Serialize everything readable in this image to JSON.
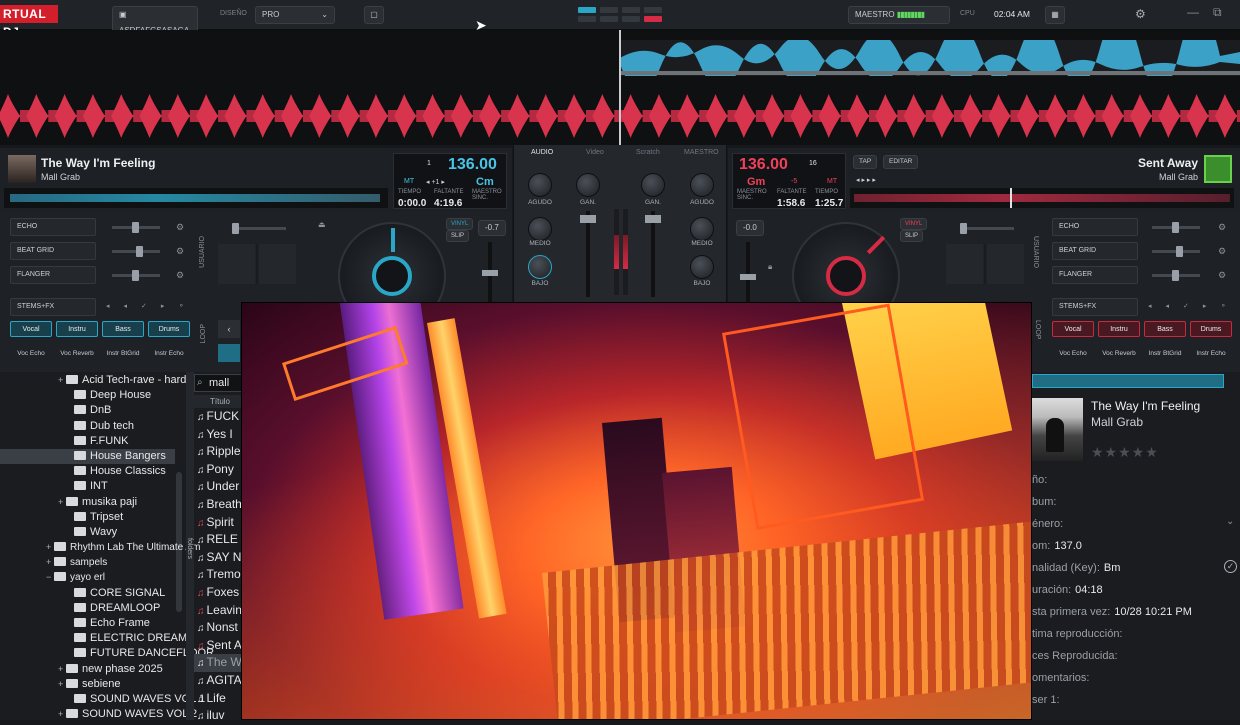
{
  "app": {
    "logo": "RTUAL DJ",
    "user": "ASDFAFGSASAGA...",
    "design_label": "DISEÑO",
    "design_value": "PRO",
    "master_label": "MAESTRO",
    "cpu_label": "CPU",
    "clock": "02:04 AM"
  },
  "left_deck": {
    "title": "The Way I'm Feeling",
    "artist": "Mall Grab",
    "bpm": "136.00",
    "key": "Cm",
    "deck_num": "1",
    "mt": "MT",
    "time_label": "TIEMPO",
    "remain_label": "FALTANTE",
    "sync_label": "MAESTRO SINC.",
    "time": "0:00.0",
    "remain": "4:19.6",
    "pitch": "-0.7",
    "vinyl": "VINYL",
    "slip": "SLIP",
    "fx": [
      "ECHO",
      "BEAT GRID",
      "FLANGER"
    ],
    "stems_label": "STEMS+FX",
    "pads": [
      "Vocal",
      "Instru",
      "Bass",
      "Drums"
    ],
    "pads2": [
      "Voc Echo",
      "Voc Reverb",
      "Instr BtGrid",
      "Instr Echo"
    ],
    "usuario": "USUARIO",
    "loop": "LOOP"
  },
  "right_deck": {
    "title": "Sent Away",
    "artist": "Mall Grab",
    "bpm": "136.00",
    "key": "Gm",
    "deck_num": "16",
    "delta": "-5",
    "mt": "MT",
    "tap": "TAP",
    "edit": "EDITAR",
    "sync_label": "MAESTRO SINC.",
    "remain_label": "FALTANTE",
    "time_label": "TIEMPO",
    "remain": "1:58.6",
    "time": "1:25.7",
    "pitch": "-0.0",
    "vinyl": "VINYL",
    "slip": "SLIP",
    "fx": [
      "ECHO",
      "BEAT GRID",
      "FLANGER"
    ],
    "stems_label": "STEMS+FX",
    "pads": [
      "Vocal",
      "Instru",
      "Bass",
      "Drums"
    ],
    "pads2": [
      "Voc Echo",
      "Voc Reverb",
      "Instr BtGrid",
      "Instr Echo"
    ],
    "usuario": "USUARIO",
    "loop": "LOOP"
  },
  "mixer": {
    "tabs": [
      "AUDIO",
      "Video",
      "Scratch",
      "MAESTRO"
    ],
    "gain": "GAN.",
    "high": "AGUDO",
    "mid": "MEDIO",
    "low": "BAJO"
  },
  "browser": {
    "folders": [
      {
        "name": "Acid Tech-rave - hard",
        "plus": true,
        "indent": 1
      },
      {
        "name": "Deep House",
        "plus": false,
        "indent": 2
      },
      {
        "name": "DnB",
        "plus": false,
        "indent": 2
      },
      {
        "name": "Dub tech",
        "plus": false,
        "indent": 2
      },
      {
        "name": "F.FUNK",
        "plus": false,
        "indent": 2
      },
      {
        "name": "House Bangers",
        "plus": false,
        "indent": 2,
        "selected": true
      },
      {
        "name": "House Classics",
        "plus": false,
        "indent": 2
      },
      {
        "name": "INT",
        "plus": false,
        "indent": 2
      },
      {
        "name": "musika paji",
        "plus": true,
        "indent": 1
      },
      {
        "name": "Tripset",
        "plus": false,
        "indent": 2
      },
      {
        "name": "Wavy",
        "plus": false,
        "indent": 2
      },
      {
        "name": "Rhythm Lab The Ultimate Am",
        "plus": true,
        "indent": 0
      },
      {
        "name": "sampels",
        "plus": true,
        "indent": 0
      },
      {
        "name": "yayo erl",
        "plus": false,
        "minus": true,
        "indent": 0
      },
      {
        "name": "CORE SIGNAL",
        "plus": false,
        "indent": 2
      },
      {
        "name": "DREAMLOOP",
        "plus": false,
        "indent": 2
      },
      {
        "name": "Echo Frame",
        "plus": false,
        "indent": 2
      },
      {
        "name": "ELECTRIC DREAMS",
        "plus": false,
        "indent": 2
      },
      {
        "name": "FUTURE DANCEFLOOR",
        "plus": false,
        "indent": 2
      },
      {
        "name": "new phase 2025",
        "plus": true,
        "indent": 1
      },
      {
        "name": "sebiene",
        "plus": true,
        "indent": 1
      },
      {
        "name": "SOUND WAVES VOL 1",
        "plus": false,
        "indent": 2
      },
      {
        "name": "SOUND WAVES VOL 2",
        "plus": true,
        "indent": 1
      }
    ],
    "search_value": "mall",
    "title_col": "Título",
    "folders_tab": "folders",
    "songs": [
      {
        "t": "FUCK",
        "red": false
      },
      {
        "t": "Yes I",
        "red": false
      },
      {
        "t": "Ripple",
        "red": false
      },
      {
        "t": "Pony",
        "red": false
      },
      {
        "t": "Under",
        "red": false
      },
      {
        "t": "Breath",
        "red": false
      },
      {
        "t": "Spirit",
        "red": true
      },
      {
        "t": "RELE",
        "red": false
      },
      {
        "t": "SAY N",
        "red": false
      },
      {
        "t": "Tremo",
        "red": false
      },
      {
        "t": "Foxes",
        "red": true
      },
      {
        "t": "Leavin",
        "red": true
      },
      {
        "t": "Nonst",
        "red": false
      },
      {
        "t": "Sent A",
        "red": true
      },
      {
        "t": "The W",
        "red": false,
        "selected": true
      },
      {
        "t": "AGITA",
        "red": false
      },
      {
        "t": "Life",
        "red": false
      },
      {
        "t": "iluv",
        "red": false
      }
    ]
  },
  "info": {
    "title": "The Way I'm Feeling",
    "artist": "Mall Grab",
    "rating": 0,
    "rows": [
      {
        "k": "ño:",
        "v": ""
      },
      {
        "k": "bum:",
        "v": ""
      },
      {
        "k": "énero:",
        "v": ""
      },
      {
        "k": "om:",
        "v": "137.0"
      },
      {
        "k": "nalidad (Key):",
        "v": "Bm"
      },
      {
        "k": "uración:",
        "v": "04:18"
      },
      {
        "k": "sta primera vez:",
        "v": "10/28 10:21 PM"
      },
      {
        "k": "tima reproducción:",
        "v": ""
      },
      {
        "k": "ces Reproducida:",
        "v": ""
      },
      {
        "k": "omentarios:",
        "v": ""
      },
      {
        "k": "ser 1:",
        "v": ""
      }
    ]
  },
  "colors": {
    "deck_left": "#2aa6c6",
    "deck_right": "#d52b45",
    "bpm_left": "#48c4e6",
    "bpm_right": "#ef4159",
    "bg": "#16181b"
  }
}
